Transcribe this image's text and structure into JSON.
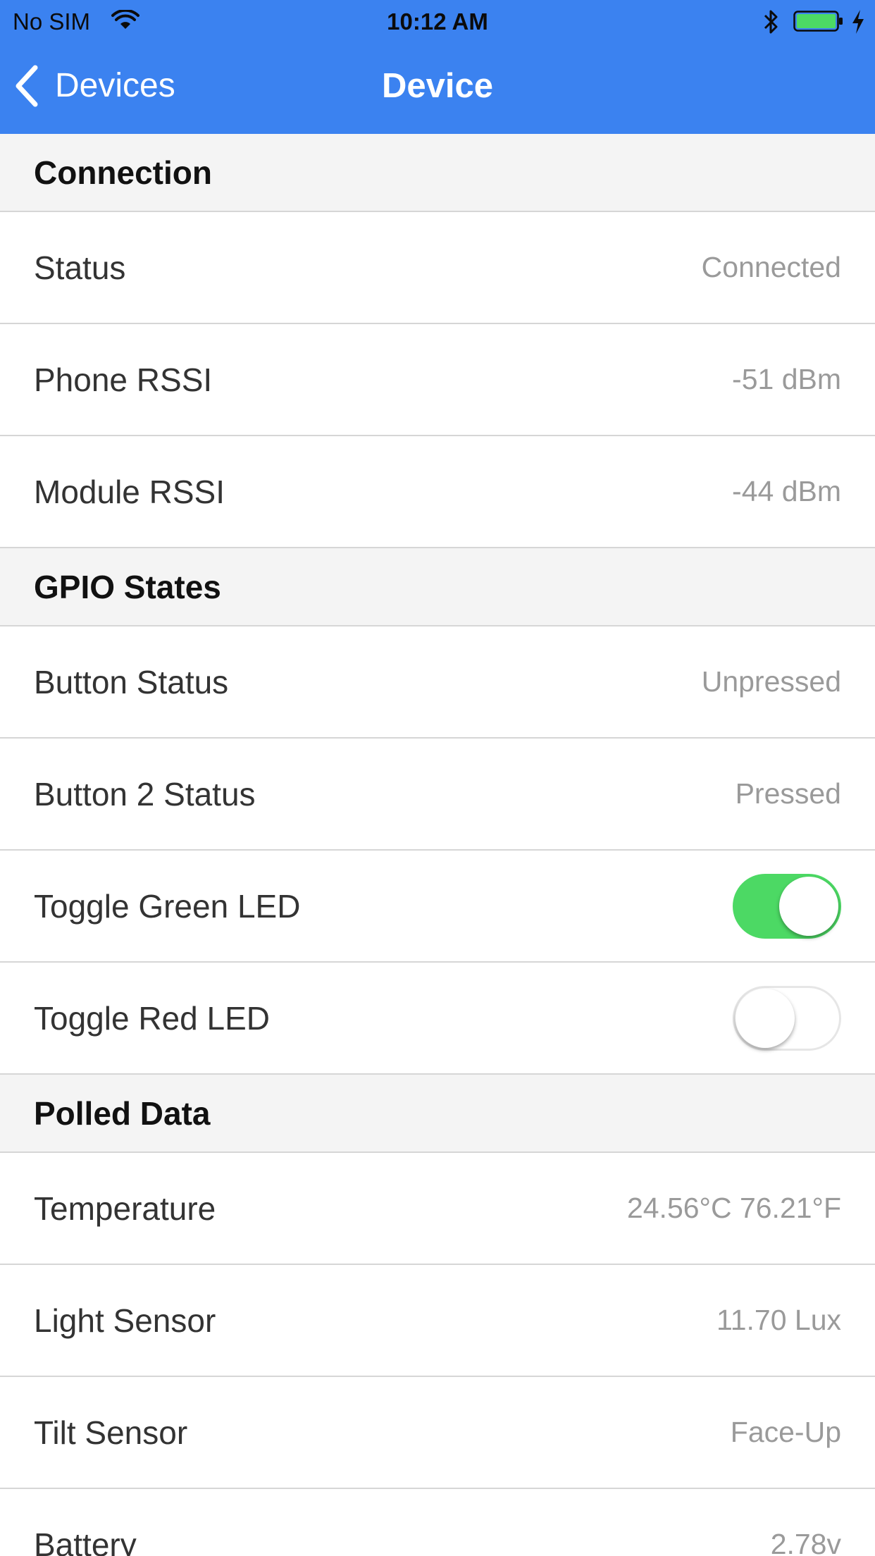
{
  "status_bar": {
    "carrier": "No SIM",
    "time": "10:12 AM",
    "icons": [
      "wifi-icon",
      "bluetooth-icon",
      "battery-icon",
      "charging-bolt-icon"
    ]
  },
  "nav": {
    "back_label": "Devices",
    "title": "Device",
    "back_icon": "chevron-left-icon"
  },
  "colors": {
    "nav_background": "#3b82f0",
    "switch_on": "#4cd964",
    "section_background": "#f4f4f4",
    "value_text": "#9a9a9a"
  },
  "sections": [
    {
      "title": "Connection",
      "rows": [
        {
          "label": "Status",
          "value": "Connected"
        },
        {
          "label": "Phone RSSI",
          "value": "-51 dBm"
        },
        {
          "label": "Module RSSI",
          "value": "-44 dBm"
        }
      ]
    },
    {
      "title": "GPIO States",
      "rows": [
        {
          "label": "Button Status",
          "value": "Unpressed"
        },
        {
          "label": "Button 2 Status",
          "value": "Pressed"
        },
        {
          "label": "Toggle Green LED",
          "toggle": true
        },
        {
          "label": "Toggle Red LED",
          "toggle": false
        }
      ]
    },
    {
      "title": "Polled Data",
      "rows": [
        {
          "label": "Temperature",
          "value": "24.56°C 76.21°F"
        },
        {
          "label": "Light Sensor",
          "value": "11.70 Lux"
        },
        {
          "label": "Tilt Sensor",
          "value": "Face-Up"
        },
        {
          "label": "Battery",
          "value": "2.78v"
        }
      ]
    }
  ]
}
